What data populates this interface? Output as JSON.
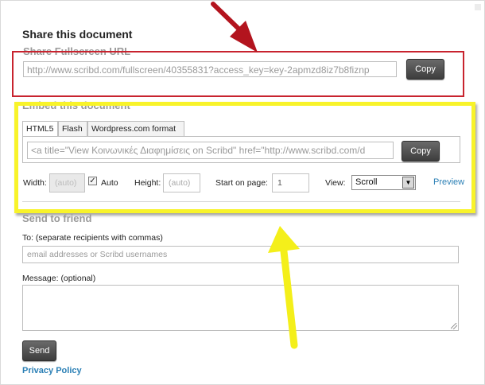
{
  "dialog": {
    "title": "Share this document"
  },
  "fullscreen": {
    "section_label": "Share Fullscreen URL",
    "url": "http://www.scribd.com/fullscreen/40355831?access_key=key-2apmzd8iz7b8fiznp",
    "copy_label": "Copy"
  },
  "embed": {
    "section_label": "Embed this document",
    "tabs": [
      {
        "label": "HTML5",
        "active": true
      },
      {
        "label": "Flash",
        "active": false
      },
      {
        "label": "Wordpress.com format",
        "active": false
      }
    ],
    "code": "<a title=\"View Κοινωνικές Διαφημίσεις on Scribd\" href=\"http://www.scribd.com/d",
    "copy_label": "Copy",
    "width_label": "Width:",
    "width_value": "(auto)",
    "auto_label": "Auto",
    "auto_checked": true,
    "height_label": "Height:",
    "height_value": "(auto)",
    "start_label": "Start on page:",
    "start_value": "1",
    "view_label": "View:",
    "view_value": "Scroll",
    "preview_label": "Preview"
  },
  "send": {
    "section_label": "Send to friend",
    "to_label": "To: (separate recipients with commas)",
    "to_placeholder": "email addresses or Scribd usernames",
    "message_label": "Message: (optional)",
    "send_label": "Send"
  },
  "footer": {
    "privacy_label": "Privacy Policy"
  },
  "colors": {
    "red_highlight": "#c8232e",
    "yellow_highlight": "#f8f32a",
    "link": "#2a7fb5",
    "button": "#4a4a4a"
  }
}
